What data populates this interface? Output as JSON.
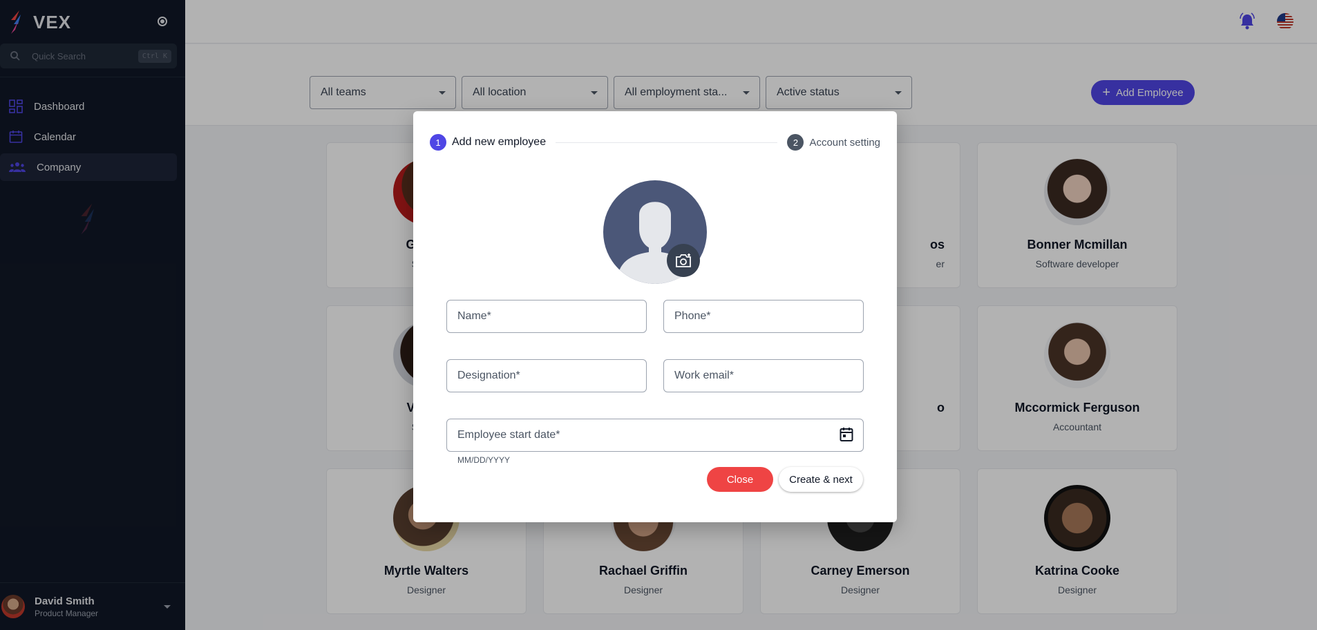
{
  "colors": {
    "accent": "#4f46e5",
    "sidebar_bg": "#111827",
    "danger": "#ef4444"
  },
  "sidebar": {
    "brand": "VEX",
    "search": {
      "placeholder": "Quick Search",
      "shortcut": "Ctrl K"
    },
    "items": [
      {
        "label": "Dashboard",
        "icon": "dashboard-icon"
      },
      {
        "label": "Calendar",
        "icon": "calendar-icon"
      },
      {
        "label": "Company",
        "icon": "company-icon",
        "active": true
      }
    ],
    "user": {
      "name": "David Smith",
      "role": "Product Manager"
    }
  },
  "filters": {
    "teams": "All teams",
    "location": "All location",
    "employment": "All employment sta...",
    "status": "Active status"
  },
  "add_button": "Add Employee",
  "employees": [
    {
      "name": "Guerre",
      "role": "Softwa"
    },
    {
      "name": "os",
      "role": "er"
    },
    {
      "name": "Bonner Mcmillan",
      "role": "Software developer"
    },
    {
      "name": "Velasq",
      "role": "Softwa"
    },
    {
      "name": "o",
      "role": ""
    },
    {
      "name": "Mccormick Ferguson",
      "role": "Accountant"
    },
    {
      "name": "Myrtle Walters",
      "role": "Designer"
    },
    {
      "name": "Rachael Griffin",
      "role": "Designer"
    },
    {
      "name": "Carney Emerson",
      "role": "Designer"
    },
    {
      "name": "Katrina Cooke",
      "role": "Designer"
    }
  ],
  "modal": {
    "step1": {
      "num": "1",
      "label": "Add new employee"
    },
    "step2": {
      "num": "2",
      "label": "Account setting"
    },
    "fields": {
      "name": "Name*",
      "phone": "Phone*",
      "designation": "Designation*",
      "work_email": "Work email*",
      "start_date": "Employee start date*"
    },
    "date_helper": "MM/DD/YYYY",
    "close": "Close",
    "create_next": "Create & next"
  }
}
